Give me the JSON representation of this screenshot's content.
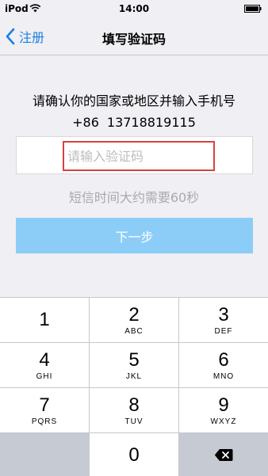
{
  "status_bar": {
    "carrier": "iPod",
    "time": "14:00"
  },
  "nav": {
    "back_label": "注册",
    "title": "填写验证码"
  },
  "form": {
    "prompt": "请确认你的国家或地区并输入手机号",
    "country_code": "+86",
    "phone_number": "13718819115",
    "code_placeholder": "请输入验证码",
    "code_value": "",
    "hint": "短信时间大约需要60秒",
    "next_label": "下一步"
  },
  "keypad": {
    "keys": [
      {
        "digit": "1",
        "letters": ""
      },
      {
        "digit": "2",
        "letters": "ABC"
      },
      {
        "digit": "3",
        "letters": "DEF"
      },
      {
        "digit": "4",
        "letters": "GHI"
      },
      {
        "digit": "5",
        "letters": "JKL"
      },
      {
        "digit": "6",
        "letters": "MNO"
      },
      {
        "digit": "7",
        "letters": "PQRS"
      },
      {
        "digit": "8",
        "letters": "TUV"
      },
      {
        "digit": "9",
        "letters": "WXYZ"
      },
      {
        "digit": "0",
        "letters": ""
      }
    ]
  },
  "colors": {
    "accent": "#1a7fe0",
    "button_disabled": "#8ccdf8",
    "highlight_border": "#d9413e",
    "background": "#efeff4"
  },
  "icons": [
    "wifi-icon",
    "battery-icon",
    "back-chevron-icon",
    "delete-icon"
  ]
}
